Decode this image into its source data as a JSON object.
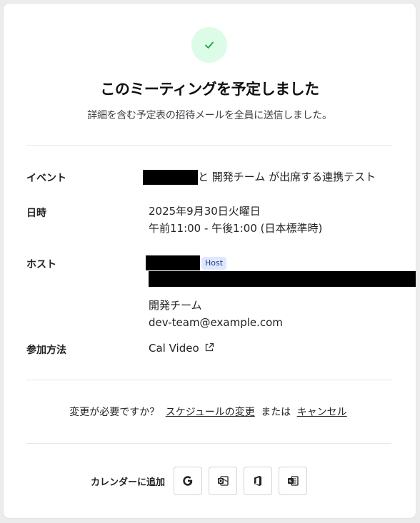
{
  "header": {
    "title": "このミーティングを予定しました",
    "subtitle": "詳細を含む予定表の招待メールを全員に送信しました。"
  },
  "details": {
    "event_label": "イベント",
    "event_value": "と 開発チーム が出席する連携テスト",
    "datetime_label": "日時",
    "date": "2025年9月30日火曜日",
    "time": "午前11:00 - 午後1:00 (日本標準時)",
    "host_label": "ホスト",
    "host_badge": "Host",
    "attendee_name": "開発チーム",
    "attendee_email": "dev-team@example.com",
    "location_label": "参加方法",
    "location_value": "Cal Video"
  },
  "change": {
    "prompt": "変更が必要ですか？",
    "reschedule": "スケジュールの変更",
    "or": "または",
    "cancel": "キャンセル"
  },
  "calendar": {
    "label": "カレンダーに追加",
    "buttons": [
      "google-icon",
      "outlook-icon",
      "office365-icon",
      "ics-icon"
    ]
  },
  "colors": {
    "success_bg": "#dcfce7",
    "success_check": "#16a34a",
    "badge_bg": "#e0e7ff"
  }
}
